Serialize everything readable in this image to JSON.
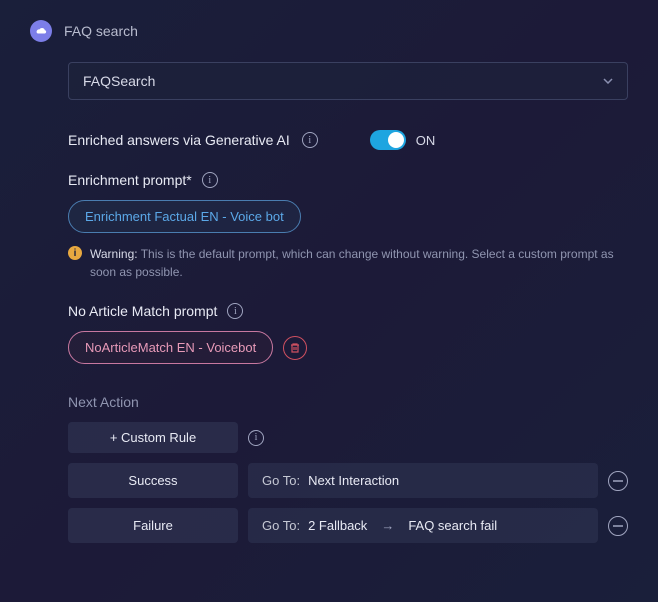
{
  "header": {
    "title": "FAQ search"
  },
  "select": {
    "value": "FAQSearch"
  },
  "enriched": {
    "label": "Enriched answers via Generative AI",
    "state": "ON"
  },
  "enrichment_prompt": {
    "label": "Enrichment prompt*",
    "chip": "Enrichment Factual EN - Voice bot"
  },
  "warning": {
    "label": "Warning:",
    "text": "This is the default prompt, which can change without warning. Select a custom prompt as soon as possible."
  },
  "no_article": {
    "label": "No Article Match prompt",
    "chip": "NoArticleMatch EN - Voicebot"
  },
  "next_action": {
    "label": "Next Action",
    "custom_rule": "+ Custom Rule",
    "success": {
      "label": "Success",
      "goto_label": "Go To:",
      "goto_value": "Next Interaction"
    },
    "failure": {
      "label": "Failure",
      "goto_label": "Go To:",
      "goto_value1": "2 Fallback",
      "goto_value2": "FAQ search fail"
    }
  }
}
